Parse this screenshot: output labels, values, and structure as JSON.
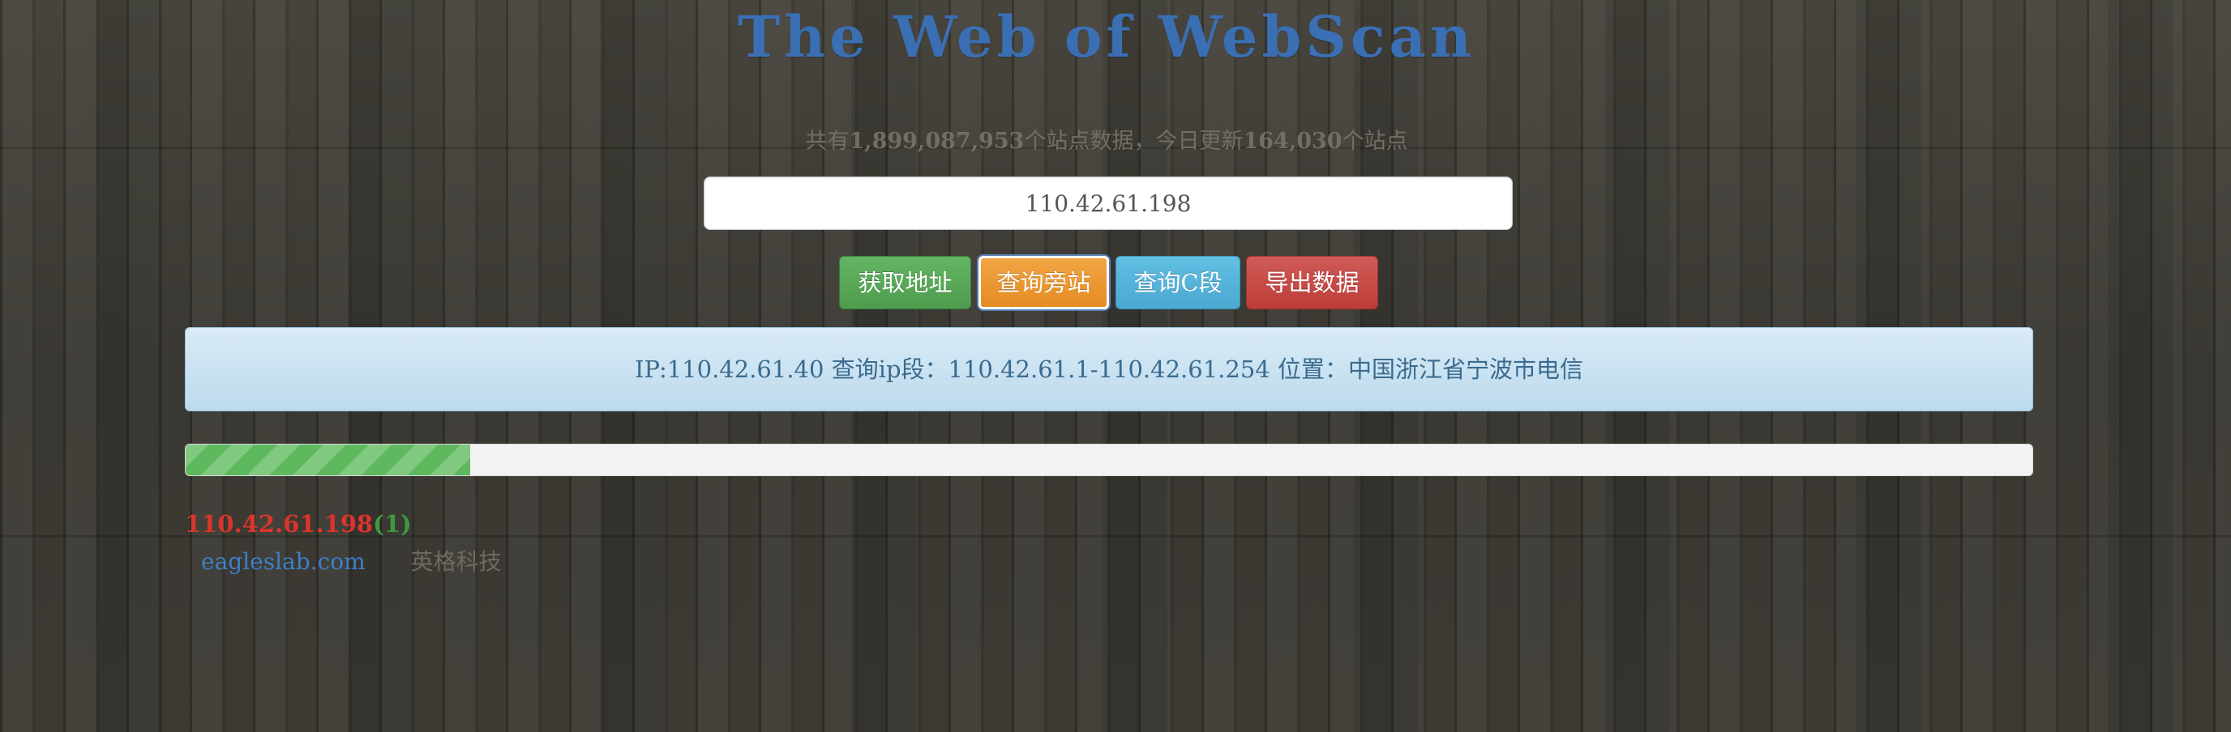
{
  "header": {
    "title": "The Web of WebScan"
  },
  "stats": {
    "prefix": "共有",
    "total_sites": "1,899,087,953",
    "middle": "个站点数据，今日更新",
    "updated_today": "164,030",
    "suffix": "个站点"
  },
  "search": {
    "value": "110.42.61.198"
  },
  "buttons": {
    "get_address": "获取地址",
    "query_sites": "查询旁站",
    "query_c_segment": "查询C段",
    "export_data": "导出数据"
  },
  "info": {
    "text": "IP:110.42.61.40 查询ip段：110.42.61.1-110.42.61.254 位置：中国浙江省宁波市电信"
  },
  "progress": {
    "fraction": 0.154,
    "color": "#5eb85e"
  },
  "results": {
    "ip": "110.42.61.198",
    "count": "(1)",
    "items": [
      {
        "domain": "eagleslab.com",
        "title": "英格科技"
      }
    ]
  },
  "colors": {
    "title": "#3b6fb3",
    "ip_red": "#d9352b",
    "count_green": "#3f9a3f",
    "domain_link": "#3d7fc9"
  }
}
